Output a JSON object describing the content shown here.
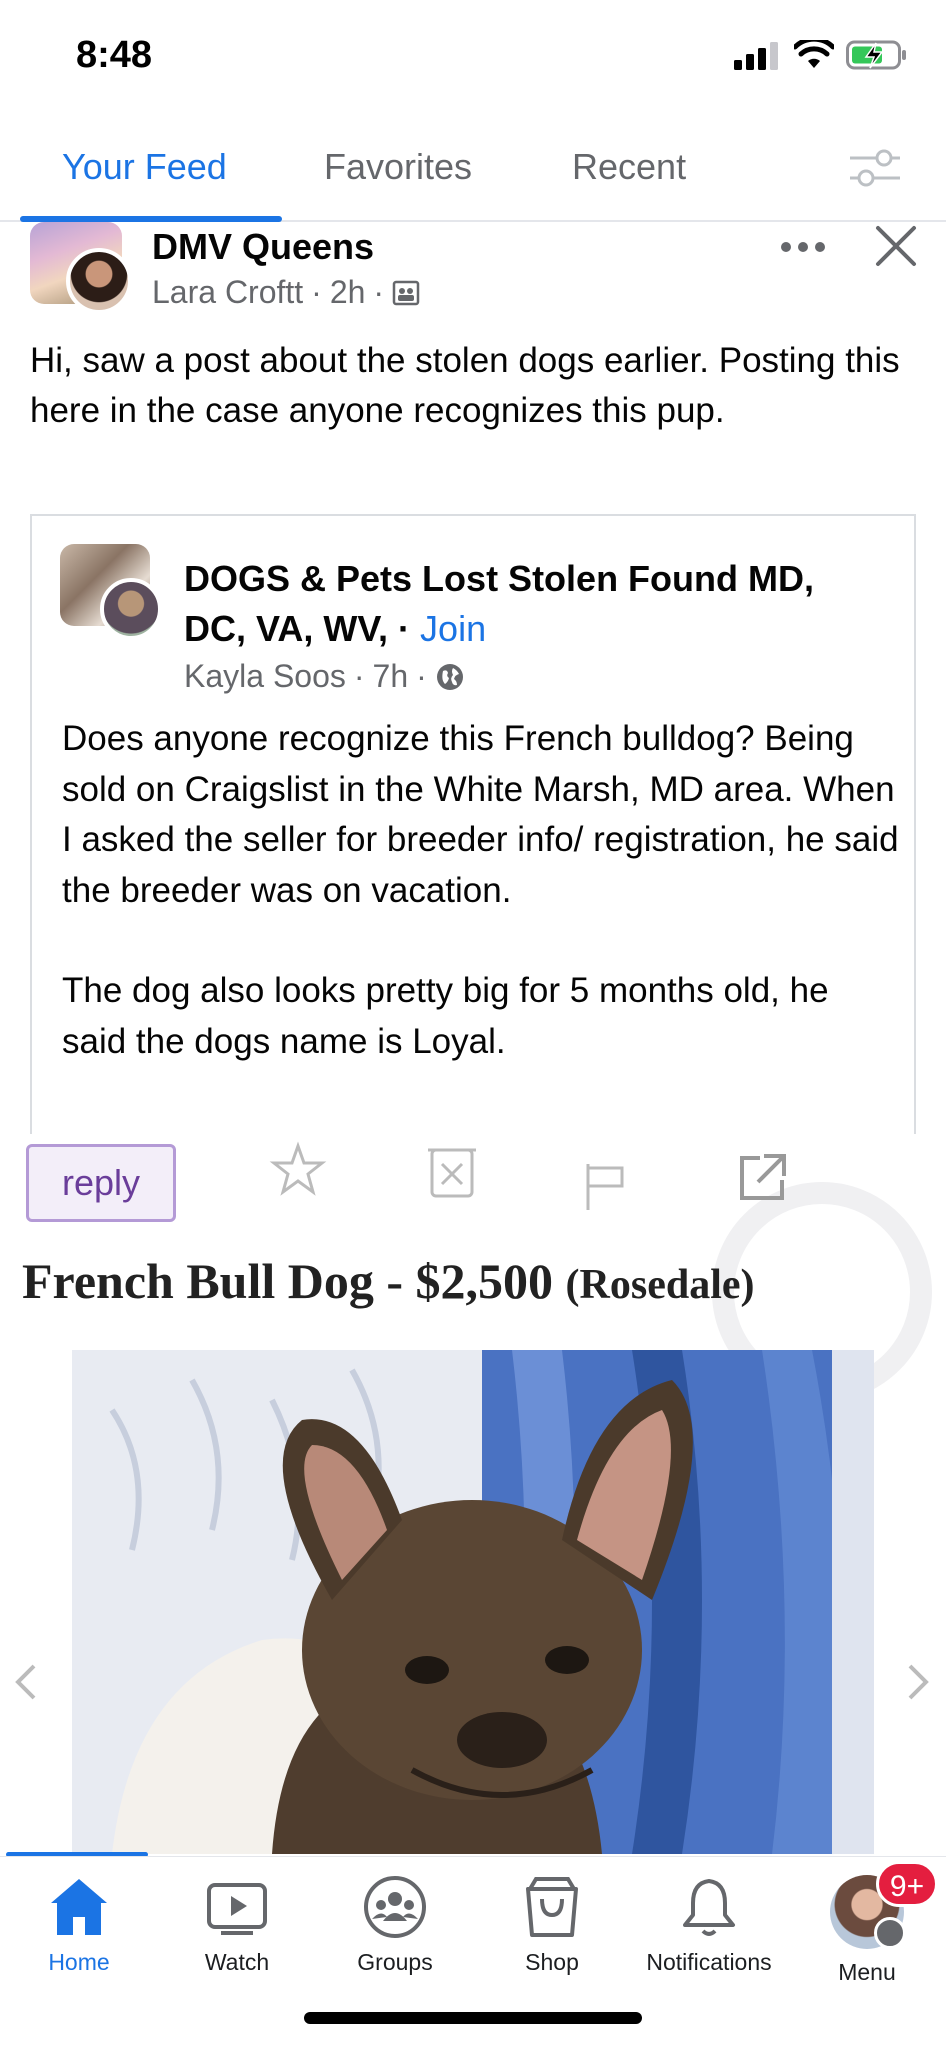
{
  "status_bar": {
    "time": "8:48"
  },
  "tabs": [
    {
      "label": "Your Feed",
      "active": true
    },
    {
      "label": "Favorites",
      "active": false
    },
    {
      "label": "Recent",
      "active": false
    }
  ],
  "post": {
    "group_name": "DMV Queens",
    "author": "Lara Croftt",
    "time": "2h",
    "text": "Hi, saw a post about the stolen dogs earlier. Posting this here in the case anyone recognizes this pup."
  },
  "shared_post": {
    "group_name": "DOGS & Pets Lost Stolen Found MD, DC, VA, WV,",
    "join_label": "Join",
    "author": "Kayla Soos",
    "time": "7h",
    "paragraphs": [
      "Does anyone recognize this French bulldog? Being sold on Craigslist in the White Marsh, MD area. When I asked the seller for breeder info/ registration, he said the breeder was on vacation.",
      "The dog also looks pretty big for 5 months old, he said the dogs name is Loyal."
    ]
  },
  "listing": {
    "reply_label": "reply",
    "title": "French Bull Dog - $2,500",
    "location": "(Rosedale)"
  },
  "bottom_nav": [
    {
      "label": "Home",
      "icon": "home-icon",
      "active": true
    },
    {
      "label": "Watch",
      "icon": "watch-icon",
      "active": false
    },
    {
      "label": "Groups",
      "icon": "groups-icon",
      "active": false
    },
    {
      "label": "Shop",
      "icon": "shop-icon",
      "active": false
    },
    {
      "label": "Notifications",
      "icon": "bell-icon",
      "active": false
    },
    {
      "label": "Menu",
      "icon": "avatar",
      "active": false,
      "badge": "9+"
    }
  ],
  "colors": {
    "accent": "#1b74e4",
    "badge": "#e41e3f",
    "secondary_text": "#65676b"
  }
}
